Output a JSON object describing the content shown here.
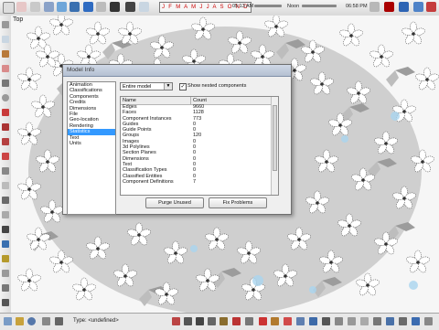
{
  "toolbar_top": {
    "months": "J F M A M J J A S O N D",
    "time_start": "05:13 AM",
    "noon": "Noon",
    "time_end": "06:58 PM"
  },
  "viewport": {
    "label": "Top"
  },
  "statusbar": {
    "type_text": "Type: <undefined>"
  },
  "dialog": {
    "title": "Model Info",
    "categories": [
      {
        "label": "Animation",
        "selected": false
      },
      {
        "label": "Classifications",
        "selected": false
      },
      {
        "label": "Components",
        "selected": false
      },
      {
        "label": "Credits",
        "selected": false
      },
      {
        "label": "Dimensions",
        "selected": false
      },
      {
        "label": "File",
        "selected": false
      },
      {
        "label": "Geo-location",
        "selected": false
      },
      {
        "label": "Rendering",
        "selected": false
      },
      {
        "label": "Statistics",
        "selected": true
      },
      {
        "label": "Text",
        "selected": false
      },
      {
        "label": "Units",
        "selected": false
      }
    ],
    "scope_select": "Entire model",
    "nested_checkbox_label": "Show nested components",
    "nested_checked": true,
    "table": {
      "headers": [
        "Name",
        "Count"
      ],
      "rows": [
        [
          "Edges",
          "9660"
        ],
        [
          "Faces",
          "1128"
        ],
        [
          "Component Instances",
          "773"
        ],
        [
          "Guides",
          "0"
        ],
        [
          "Guide Points",
          "0"
        ],
        [
          "Groups",
          "120"
        ],
        [
          "Images",
          "0"
        ],
        [
          "3d Polylines",
          "0"
        ],
        [
          "Section Planes",
          "0"
        ],
        [
          "Dimensions",
          "0"
        ],
        [
          "Text",
          "0"
        ],
        [
          "Classification Types",
          "0"
        ],
        [
          "Classified Entities",
          "0"
        ],
        [
          "Component Definitions",
          "7"
        ]
      ]
    },
    "purge_button": "Purge Unused",
    "fix_button": "Fix Problems"
  }
}
